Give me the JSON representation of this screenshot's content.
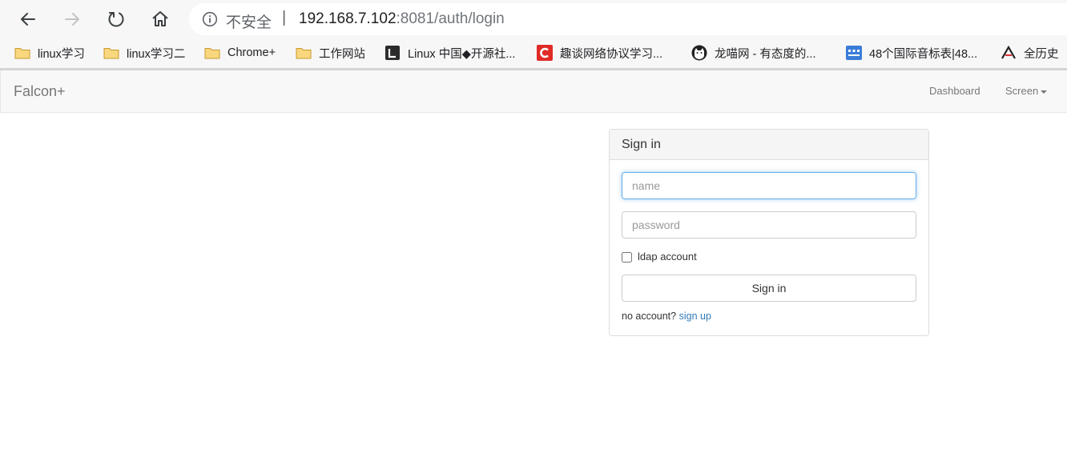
{
  "browser": {
    "address": {
      "security_label": "不安全",
      "separator": "|",
      "host": "192.168.7.102",
      "path": ":8081/auth/login"
    },
    "bookmarks": [
      {
        "label": "linux学习",
        "icon": "folder-icon"
      },
      {
        "label": "linux学习二",
        "icon": "folder-icon"
      },
      {
        "label": "Chrome+",
        "icon": "folder-icon"
      },
      {
        "label": "工作网站",
        "icon": "folder-icon"
      },
      {
        "label": "Linux 中国◆开源社...",
        "icon": "linux-china-icon"
      },
      {
        "label": "趣谈网络协议学习...",
        "icon": "geektime-icon"
      },
      {
        "label": "龙喵网 - 有态度的...",
        "icon": "cat-icon"
      },
      {
        "label": "48个国际音标表|48...",
        "icon": "phonetic-icon"
      },
      {
        "label": "全历史",
        "icon": "history-icon"
      }
    ]
  },
  "navbar": {
    "brand": "Falcon+",
    "links": [
      {
        "label": "Dashboard"
      },
      {
        "label": "Screen"
      }
    ]
  },
  "login": {
    "heading": "Sign in",
    "name_placeholder": "name",
    "password_placeholder": "password",
    "ldap_label": "ldap account",
    "submit_label": "Sign in",
    "no_account_text": "no account?",
    "signup_link": "sign up"
  },
  "colors": {
    "link": "#337ab7",
    "focus_border": "#66afe9",
    "folder": "#f5c242",
    "geektime_red": "#e02a26"
  }
}
